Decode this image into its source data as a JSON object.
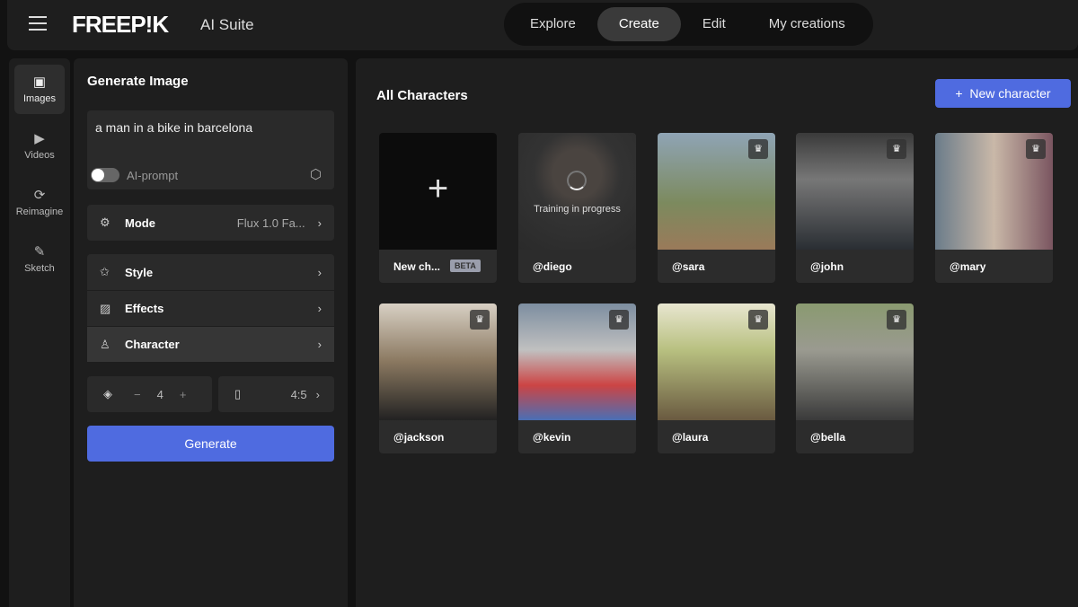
{
  "header": {
    "logo": "FREEP!K",
    "suite": "AI Suite",
    "nav": [
      {
        "label": "Explore"
      },
      {
        "label": "Create",
        "active": true
      },
      {
        "label": "Edit"
      },
      {
        "label": "My creations"
      }
    ]
  },
  "rail": [
    {
      "label": "Images",
      "icon": "images-icon"
    },
    {
      "label": "Videos",
      "icon": "video-icon"
    },
    {
      "label": "Reimagine",
      "icon": "refresh-icon"
    },
    {
      "label": "Sketch",
      "icon": "brush-icon"
    }
  ],
  "panel": {
    "title": "Generate Image",
    "prompt": "a man in a bike in barcelona",
    "ai_prompt": "AI-prompt",
    "ai_prompt_on": false,
    "mode_label": "Mode",
    "mode_value": "Flux 1.0 Fa...",
    "style": "Style",
    "effects": "Effects",
    "character": "Character",
    "count": "4",
    "minus": "−",
    "plus": "+",
    "ratio": "4:5",
    "generate": "Generate"
  },
  "main": {
    "title": "All Characters",
    "new_button": "New character",
    "new_card": "New ch...",
    "beta": "BETA",
    "training": "Training in progress",
    "characters": [
      {
        "name": "@diego"
      },
      {
        "name": "@sara"
      },
      {
        "name": "@john"
      },
      {
        "name": "@mary"
      },
      {
        "name": "@jackson"
      },
      {
        "name": "@kevin"
      },
      {
        "name": "@laura"
      },
      {
        "name": "@bella"
      }
    ]
  },
  "colors": {
    "accent": "#4f6be0"
  }
}
